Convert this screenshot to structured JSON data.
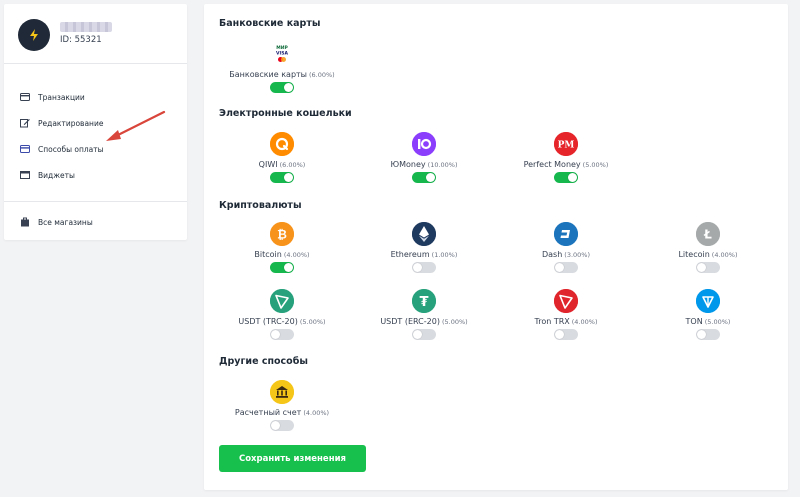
{
  "sidebar": {
    "user_id": "ID: 55321",
    "items": [
      {
        "label": "Транзакции",
        "icon": "transactions-icon"
      },
      {
        "label": "Редактирование",
        "icon": "edit-icon"
      },
      {
        "label": "Способы оплаты",
        "icon": "card-icon"
      },
      {
        "label": "Виджеты",
        "icon": "widget-icon"
      }
    ],
    "stores_label": "Все магазины"
  },
  "sections": {
    "bank": {
      "title": "Банковские карты",
      "methods": [
        {
          "label": "Банковские карты",
          "pct": "(6.00%)",
          "enabled": true,
          "icon": "bank-cards-icon"
        }
      ]
    },
    "ewallets": {
      "title": "Электронные кошельки",
      "methods": [
        {
          "label": "QIWI",
          "pct": "(6.00%)",
          "enabled": true,
          "icon": "qiwi-icon",
          "color": "#ff8c00"
        },
        {
          "label": "ЮMoney",
          "pct": "(10.00%)",
          "enabled": true,
          "icon": "yoomoney-icon",
          "color": "#8b3ffd",
          "glyph": "Ю"
        },
        {
          "label": "Perfect Money",
          "pct": "(5.00%)",
          "enabled": true,
          "icon": "perfect-money-icon",
          "color": "#e5252a",
          "glyph": "PM"
        }
      ]
    },
    "crypto": {
      "title": "Криптовалюты",
      "methods": [
        {
          "label": "Bitcoin",
          "pct": "(4.00%)",
          "enabled": true,
          "icon": "bitcoin-icon",
          "color": "#f7931a",
          "glyph": "₿"
        },
        {
          "label": "Ethereum",
          "pct": "(1.00%)",
          "enabled": false,
          "icon": "ethereum-icon",
          "color": "#1f3a5f"
        },
        {
          "label": "Dash",
          "pct": "(3.00%)",
          "enabled": false,
          "icon": "dash-icon",
          "color": "#1c75bc",
          "glyph": "D"
        },
        {
          "label": "Litecoin",
          "pct": "(4.00%)",
          "enabled": false,
          "icon": "litecoin-icon",
          "color": "#a6a9aa",
          "glyph": "Ł"
        },
        {
          "label": "USDT (TRC-20)",
          "pct": "(5.00%)",
          "enabled": false,
          "icon": "usdt-trc20-icon",
          "color": "#26a17b"
        },
        {
          "label": "USDT (ERC-20)",
          "pct": "(5.00%)",
          "enabled": false,
          "icon": "usdt-erc20-icon",
          "color": "#26a17b",
          "glyph": "₮"
        },
        {
          "label": "Tron TRX",
          "pct": "(4.00%)",
          "enabled": false,
          "icon": "tron-icon",
          "color": "#e0252c"
        },
        {
          "label": "TON",
          "pct": "(5.00%)",
          "enabled": false,
          "icon": "ton-icon",
          "color": "#0098ea"
        }
      ]
    },
    "other": {
      "title": "Другие способы",
      "methods": [
        {
          "label": "Расчетный счет",
          "pct": "(4.00%)",
          "enabled": false,
          "icon": "bank-account-icon",
          "color": "#f5c518"
        }
      ]
    }
  },
  "save_label": "Сохранить изменения",
  "colors": {
    "toggle_on": "#16b84e",
    "toggle_off": "#d8dbe0",
    "save_button": "#17c04c",
    "arrow": "#d9453b"
  }
}
